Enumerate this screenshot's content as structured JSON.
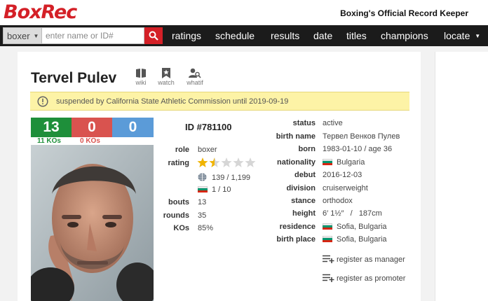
{
  "header": {
    "logo": "BoxRec",
    "tagline": "Boxing's Official Record Keeper"
  },
  "search": {
    "type": "boxer",
    "placeholder": "enter name or ID#"
  },
  "nav": [
    "ratings",
    "schedule",
    "results",
    "date",
    "titles",
    "champions",
    "locate"
  ],
  "boxer": {
    "name": "Tervel Pulev",
    "actions": [
      "wiki",
      "watch",
      "whatif"
    ],
    "alert": "suspended by California State Athletic Commission until 2019-09-19",
    "record": {
      "wins": "13",
      "losses": "0",
      "draws": "0",
      "wins_ko": "11 KOs",
      "losses_ko": "0 KOs"
    },
    "id": "ID #781100",
    "left_fields": {
      "role_label": "role",
      "role": "boxer",
      "rating_label": "rating",
      "rating_stars": 1.5,
      "world_rank": "139 / 1,199",
      "country_rank": "1 / 10",
      "bouts_label": "bouts",
      "bouts": "13",
      "rounds_label": "rounds",
      "rounds": "35",
      "kos_label": "KOs",
      "kos": "85%"
    },
    "right_fields": [
      {
        "label": "status",
        "value": "active"
      },
      {
        "label": "birth name",
        "value": "Тервел Венков Пулев"
      },
      {
        "label": "born",
        "value": "1983-01-10 / age 36"
      },
      {
        "label": "nationality",
        "value": "Bulgaria",
        "flag": true
      },
      {
        "label": "debut",
        "value": "2016-12-03"
      },
      {
        "label": "division",
        "value": "cruiserweight"
      },
      {
        "label": "stance",
        "value": "orthodox"
      },
      {
        "label": "height",
        "value": "6′ 1½″   /   187cm"
      },
      {
        "label": "residence",
        "value": "Sofia, Bulgaria",
        "flag": true
      },
      {
        "label": "birth place",
        "value": "Sofia, Bulgaria",
        "flag": true
      }
    ],
    "register_manager": "register as manager",
    "register_promoter": "register as promoter"
  },
  "colors": {
    "brand_red": "#d42027",
    "win_green": "#1e8f3a",
    "loss_red": "#d9534f",
    "draw_blue": "#5b9bd8",
    "alert_bg": "#fdf3a6",
    "star_gold": "#f0b400"
  }
}
